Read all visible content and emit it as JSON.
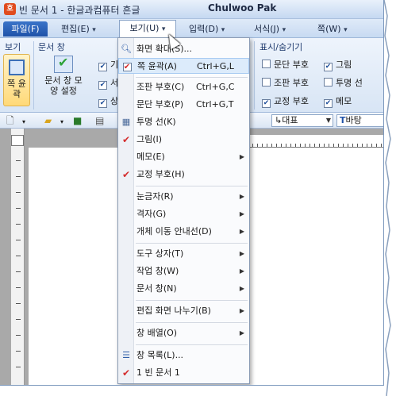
{
  "window": {
    "app_icon": "호",
    "title": "빈 문서 1 - 한글과컴퓨터 흔글",
    "user": "Chulwoo Pak"
  },
  "menubar": {
    "file": "파일(F)",
    "edit": "편집(E)",
    "view": "보기(U)",
    "input": "입력(D)",
    "format": "서식(J)",
    "page": "쪽(W)"
  },
  "ribbon": {
    "group_view": "보기",
    "group_doc_window": "문서 창",
    "group_show_hide": "표시/숨기기",
    "page_outline_btn": "쪽 윤곽",
    "doc_window_style_btn": "문서 창 모양 설정",
    "left_checks": [
      "기",
      "서",
      "상"
    ],
    "checks": [
      {
        "label": "문단 부호",
        "checked": false
      },
      {
        "label": "그림",
        "checked": true
      },
      {
        "label": "조판 부호",
        "checked": false
      },
      {
        "label": "투명 선",
        "checked": false
      },
      {
        "label": "교정 부호",
        "checked": true
      },
      {
        "label": "메모",
        "checked": true
      }
    ]
  },
  "toolbar": {
    "style_combo": "대표",
    "font_combo": "바탕"
  },
  "view_menu": {
    "items": [
      {
        "label": "화면 확대(S)...",
        "shortcut": "",
        "icon": "zoom-icon",
        "submenu": false
      },
      {
        "label": "쪽 윤곽(A)",
        "shortcut": "Ctrl+G,L",
        "icon": "checkbox-checked-icon",
        "submenu": false
      },
      {
        "label": "조판 부호(C)",
        "shortcut": "Ctrl+G,C",
        "icon": "",
        "submenu": false
      },
      {
        "label": "문단 부호(P)",
        "shortcut": "Ctrl+G,T",
        "icon": "",
        "submenu": false
      },
      {
        "label": "투명 선(K)",
        "shortcut": "",
        "icon": "grid-icon",
        "submenu": false
      },
      {
        "label": "그림(I)",
        "shortcut": "",
        "icon": "check-icon",
        "submenu": false
      },
      {
        "label": "메모(E)",
        "shortcut": "",
        "icon": "",
        "submenu": true
      },
      {
        "label": "교정 부호(H)",
        "shortcut": "",
        "icon": "check-icon",
        "submenu": false
      },
      {
        "label": "눈금자(R)",
        "shortcut": "",
        "icon": "",
        "submenu": true
      },
      {
        "label": "격자(G)",
        "shortcut": "",
        "icon": "",
        "submenu": true
      },
      {
        "label": "개체 이동 안내선(D)",
        "shortcut": "",
        "icon": "",
        "submenu": true
      },
      {
        "label": "도구 상자(T)",
        "shortcut": "",
        "icon": "",
        "submenu": true
      },
      {
        "label": "작업 창(W)",
        "shortcut": "",
        "icon": "",
        "submenu": true
      },
      {
        "label": "문서 창(N)",
        "shortcut": "",
        "icon": "",
        "submenu": true
      },
      {
        "label": "편집 화면 나누기(B)",
        "shortcut": "",
        "icon": "",
        "submenu": true
      },
      {
        "label": "창 배열(O)",
        "shortcut": "",
        "icon": "",
        "submenu": true
      },
      {
        "label": "창 목록(L)...",
        "shortcut": "",
        "icon": "window-list-icon",
        "submenu": false
      },
      {
        "label": "1 빈 문서 1",
        "shortcut": "",
        "icon": "check-icon",
        "submenu": false
      }
    ]
  },
  "colors": {
    "accent": "#1f52a8",
    "check_red": "#d42d2d",
    "ribbon_bg": "#eef4fc",
    "highlight": "#dcebfb"
  }
}
